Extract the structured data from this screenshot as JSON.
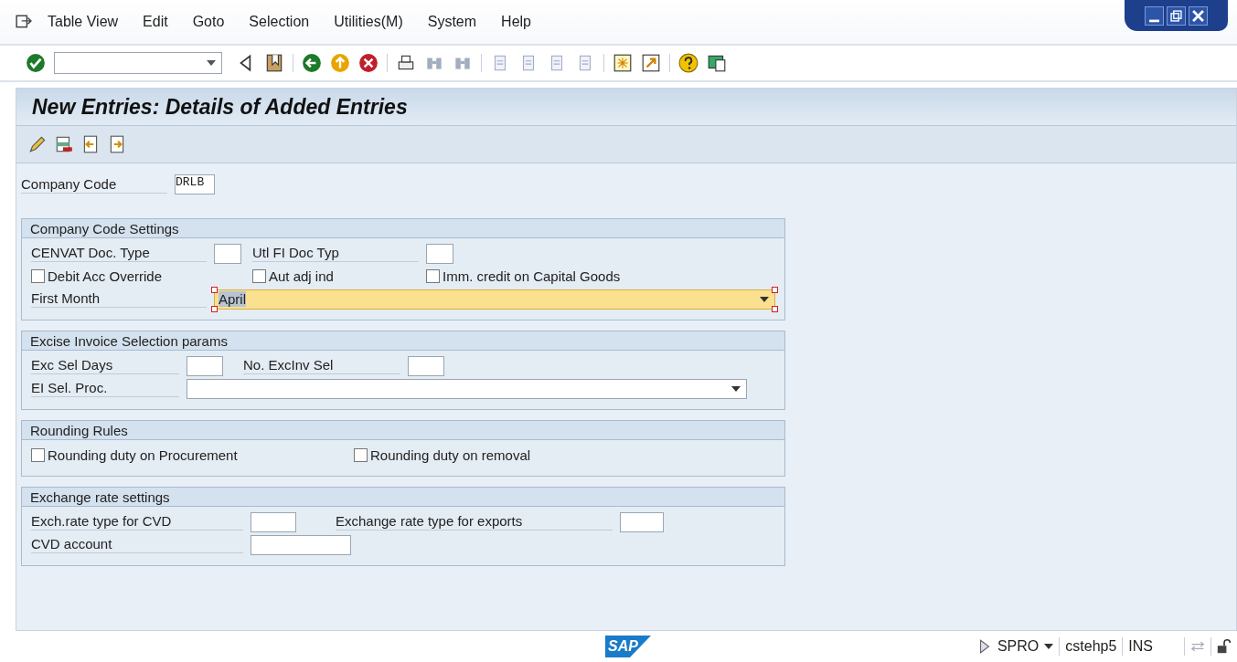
{
  "menu": [
    "Table View",
    "Edit",
    "Goto",
    "Selection",
    "Utilities(M)",
    "System",
    "Help"
  ],
  "title": "New Entries: Details of Added Entries",
  "company_code": {
    "label": "Company Code",
    "value": "DRLB"
  },
  "groups": [
    {
      "title": "Company Code Settings",
      "rows": [
        [
          {
            "kind": "label",
            "text": "CENVAT Doc. Type"
          },
          {
            "kind": "input"
          },
          {
            "kind": "label",
            "text": "Utl FI Doc Typ"
          },
          {
            "kind": "input"
          }
        ],
        [
          {
            "kind": "checkbox",
            "text": "Debit Acc Override",
            "checked": false
          },
          "",
          {
            "kind": "checkbox",
            "text": "Aut adj ind",
            "checked": false
          },
          {
            "kind": "checkbox",
            "text": "Imm. credit on Capital Goods",
            "checked": false
          }
        ],
        [
          {
            "kind": "label",
            "text": "First Month"
          },
          {
            "kind": "dropdown",
            "value": "April",
            "focused": true
          }
        ]
      ]
    },
    {
      "title": "Excise Invoice Selection params",
      "rows": [
        [
          {
            "kind": "label",
            "text": "Exc Sel Days"
          },
          {
            "kind": "input"
          },
          {
            "kind": "label",
            "text": "No. ExcInv Sel"
          },
          {
            "kind": "input"
          }
        ],
        [
          {
            "kind": "label",
            "text": "EI Sel. Proc."
          },
          {
            "kind": "dropdown",
            "focused": false
          }
        ]
      ]
    },
    {
      "title": "Rounding Rules",
      "rows": [
        [
          {
            "kind": "checkbox",
            "text": "Rounding duty on Procurement",
            "checked": false
          },
          {
            "kind": "checkbox",
            "text": "Rounding duty on removal",
            "checked": false
          }
        ]
      ]
    },
    {
      "title": "Exchange rate settings",
      "rows": [
        [
          {
            "kind": "label",
            "text": "Exch.rate type for CVD"
          },
          {
            "kind": "input"
          },
          {
            "kind": "label",
            "text": "Exchange rate type for exports"
          },
          {
            "kind": "input"
          }
        ],
        [
          {
            "kind": "label",
            "text": "CVD account"
          },
          {
            "kind": "input"
          }
        ]
      ]
    }
  ],
  "status_bar": {
    "logo": "SAP",
    "transaction": "SPRO",
    "server": "cstehp5",
    "mode": "INS"
  }
}
